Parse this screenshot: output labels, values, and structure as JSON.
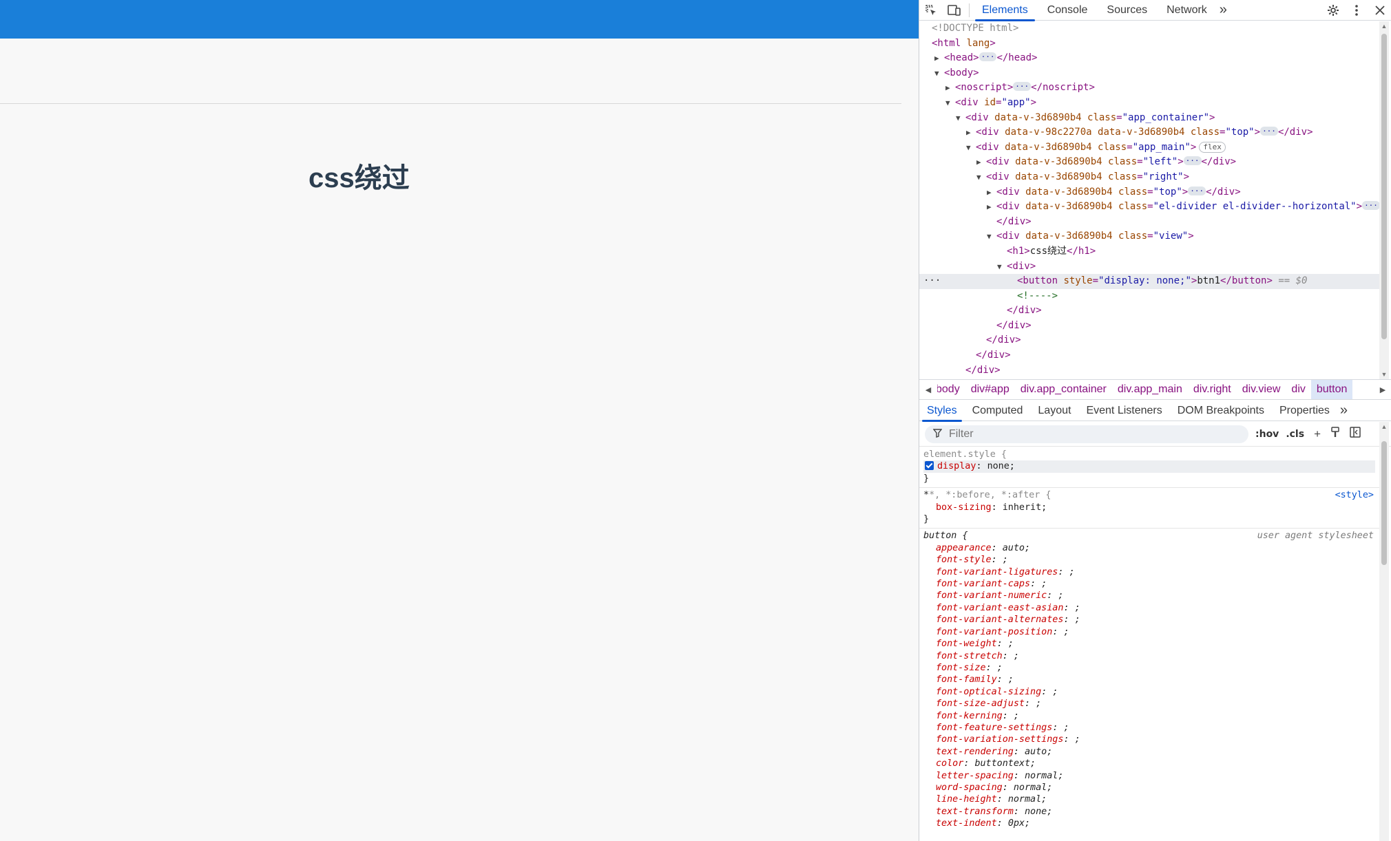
{
  "page": {
    "heading": "css绕过"
  },
  "devtools": {
    "tabs": [
      "Elements",
      "Console",
      "Sources",
      "Network"
    ],
    "more_tabs_glyph": "»",
    "dom": [
      {
        "t": "doctype",
        "text": "<!DOCTYPE html>"
      },
      {
        "t": "html"
      }
    ],
    "dom_lines": {
      "l01": "<!DOCTYPE html>",
      "l02_tag": "<html",
      "l02_attr": " lang",
      "l02_end": ">",
      "l03_open": "<head>",
      "l03_close": "</head>",
      "l04": "<body>",
      "l05_open": "<noscript>",
      "l05_close": "</noscript>",
      "l06_tag": "<div ",
      "l06_an": "id",
      "l06_av": "\"app\"",
      "l07_tag": "<div ",
      "l07_an1": "data-v-3d6890b4 ",
      "l07_an2": "class",
      "l07_av": "\"app_container\"",
      "l08_tag": "<div ",
      "l08_an1": "data-v-98c2270a data-v-3d6890b4 ",
      "l08_an2": "class",
      "l08_av": "\"top\"",
      "l08_close": "</div>",
      "l09_tag": "<div ",
      "l09_an1": "data-v-3d6890b4 ",
      "l09_an2": "class",
      "l09_av": "\"app_main\"",
      "l09_badge": "flex",
      "l10_tag": "<div ",
      "l10_an1": "data-v-3d6890b4 ",
      "l10_an2": "class",
      "l10_av": "\"left\"",
      "l10_close": "</div>",
      "l11_tag": "<div ",
      "l11_an1": "data-v-3d6890b4 ",
      "l11_an2": "class",
      "l11_av": "\"right\"",
      "l12_tag": "<div ",
      "l12_an1": "data-v-3d6890b4 ",
      "l12_an2": "class",
      "l12_av": "\"top\"",
      "l12_close": "</div>",
      "l13_tag": "<div ",
      "l13_an1": "data-v-3d6890b4 ",
      "l13_an2": "class",
      "l13_av": "\"el-divider el-divider--horizontal\"",
      "l14": "</div>",
      "l15_tag": "<div ",
      "l15_an1": "data-v-3d6890b4 ",
      "l15_an2": "class",
      "l15_av": "\"view\"",
      "l16_open": "<h1>",
      "l16_text": "css绕过",
      "l16_close": "</h1>",
      "l17": "<div>",
      "l18_tag": "<button ",
      "l18_an": "style",
      "l18_av": "\"display: none;\"",
      "l18_text": "btn1",
      "l18_close": "</button>",
      "l18_eq": " == $0",
      "l19": "<!---->",
      "l20": "</div>",
      "l21": "</div>",
      "l22": "</div>",
      "l23": "</div>",
      "l24": "</div>"
    },
    "breadcrumb": [
      "body",
      "div#app",
      "div.app_container",
      "div.app_main",
      "div.right",
      "div.view",
      "div",
      "button"
    ],
    "styles_tabs": [
      "Styles",
      "Computed",
      "Layout",
      "Event Listeners",
      "DOM Breakpoints",
      "Properties"
    ],
    "filter": {
      "placeholder": "Filter",
      "hov": ":hov",
      "cls": ".cls"
    },
    "rules": {
      "r1_selector": "element.style {",
      "r1_pname": "display",
      "r1_pval": "none;",
      "r2_selector": "*, *:before, *:after {",
      "r2_source": "<style>",
      "r2_pname": "box-sizing",
      "r2_pval": "inherit;",
      "r3_selector": "button {",
      "r3_source": "user agent stylesheet",
      "r3_decls": [
        [
          "appearance",
          "auto;"
        ],
        [
          "font-style",
          ";"
        ],
        [
          "font-variant-ligatures",
          ";"
        ],
        [
          "font-variant-caps",
          ";"
        ],
        [
          "font-variant-numeric",
          ";"
        ],
        [
          "font-variant-east-asian",
          ";"
        ],
        [
          "font-variant-alternates",
          ";"
        ],
        [
          "font-variant-position",
          ";"
        ],
        [
          "font-weight",
          ";"
        ],
        [
          "font-stretch",
          ";"
        ],
        [
          "font-size",
          ";"
        ],
        [
          "font-family",
          ";"
        ],
        [
          "font-optical-sizing",
          ";"
        ],
        [
          "font-size-adjust",
          ";"
        ],
        [
          "font-kerning",
          ";"
        ],
        [
          "font-feature-settings",
          ";"
        ],
        [
          "font-variation-settings",
          ";"
        ],
        [
          "text-rendering",
          "auto;"
        ],
        [
          "color",
          "buttontext;"
        ],
        [
          "letter-spacing",
          "normal;"
        ],
        [
          "word-spacing",
          "normal;"
        ],
        [
          "line-height",
          "normal;"
        ],
        [
          "text-transform",
          "none;"
        ],
        [
          "text-indent",
          "0px;"
        ]
      ],
      "close_brace": "}"
    },
    "colors": {
      "accent": "#0b57d0",
      "page_topbar": "#1a7fd9"
    }
  }
}
